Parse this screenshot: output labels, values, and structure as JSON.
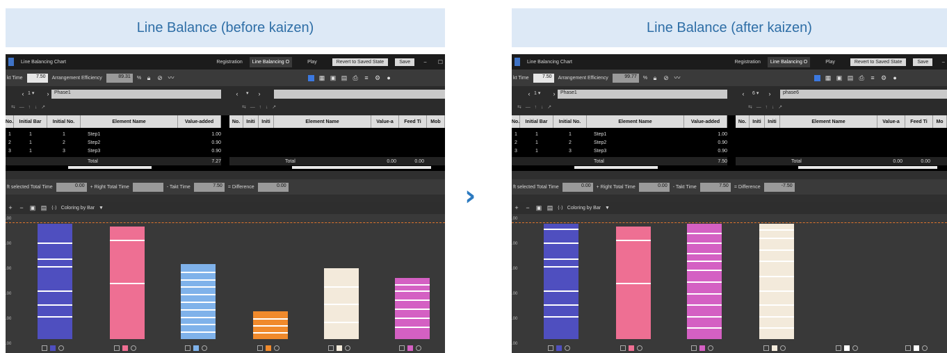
{
  "left": {
    "title": "Line Balance (before kaizen)",
    "app_title": "Line Balancing Chart",
    "tabs": [
      "Registration",
      "Line Balancing O",
      "Play"
    ],
    "revert_label": "Revert to Saved State",
    "save_label": "Save",
    "takt_label": "kt Time",
    "takt_value": "7.50",
    "efficiency_label": "Arrangement Efficiency",
    "efficiency_value": "89.31",
    "percent": "%",
    "phase_left": "Phase1",
    "phase_right": "",
    "left_headers": [
      "No.",
      "Initial Bar",
      "Initial No.",
      "Element Name",
      "Value-added"
    ],
    "right_headers": [
      "No.",
      "Initi",
      "Initi",
      "Element Name",
      "Value-a",
      "Feed Ti",
      "Mob"
    ],
    "rows": [
      {
        "no": "1",
        "bar": "1",
        "ino": "1",
        "name": "Step1",
        "value": "1.00"
      },
      {
        "no": "2",
        "bar": "1",
        "ino": "2",
        "name": "Step2",
        "value": "0.90"
      },
      {
        "no": "3",
        "bar": "1",
        "ino": "3",
        "name": "Step3",
        "value": "0.90"
      }
    ],
    "total_label": "Total",
    "total_value": "7.27",
    "right_total_label": "Total",
    "right_total_values": [
      "0.00",
      "0.00"
    ],
    "sum_left_label": "ft selected Total Time",
    "sum_left_value": "0.00",
    "sum_plus_label": "+ Right Total Time",
    "sum_right_value": "",
    "sum_takt_label": "- Takt Time",
    "sum_takt_value": "7.50",
    "sum_diff_label": "= Difference",
    "sum_diff_value": "0.00",
    "coloring_label": "Coloring by Bar",
    "y_ticks": [
      ".00",
      ".00",
      ".00",
      ".00",
      ".00",
      ".00"
    ]
  },
  "right": {
    "title": "Line Balance (after kaizen)",
    "app_title": "Line Balancing Chart",
    "tabs": [
      "Registration",
      "Line Balancing O",
      "Play"
    ],
    "revert_label": "Revert to Saved State",
    "save_label": "Save",
    "takt_label": "kt Time",
    "takt_value": "7.50",
    "efficiency_label": "Arrangement Efficiency",
    "efficiency_value": "99.77",
    "percent": "%",
    "phase_left": "Phase1",
    "phase_right": "phase6",
    "left_headers": [
      "No.",
      "Initial Bar",
      "Initial No.",
      "Element Name",
      "Value-added"
    ],
    "right_headers": [
      "No.",
      "Initi",
      "Initi",
      "Element Name",
      "Value-a",
      "Feed Ti",
      "Mo"
    ],
    "rows": [
      {
        "no": "1",
        "bar": "1",
        "ino": "1",
        "name": "Step1",
        "value": "1.00"
      },
      {
        "no": "2",
        "bar": "1",
        "ino": "2",
        "name": "Step2",
        "value": "0.90"
      },
      {
        "no": "3",
        "bar": "1",
        "ino": "3",
        "name": "Step3",
        "value": "0.90"
      }
    ],
    "total_label": "Total",
    "total_value": "7.50",
    "right_total_label": "Total",
    "right_total_values": [
      "0.00",
      "0.00"
    ],
    "sum_left_label": "ft selected Total Time",
    "sum_left_value": "0.00",
    "sum_plus_label": "+ Right Total Time",
    "sum_right_value": "0.00",
    "sum_takt_label": "- Takt Time",
    "sum_takt_value": "7.50",
    "sum_diff_label": "= Difference",
    "sum_diff_value": "-7.50",
    "coloring_label": "Coloring by Bar",
    "y_ticks": [
      ".00",
      ".00",
      ".00",
      ".00",
      ".00",
      ".00"
    ]
  },
  "colors": {
    "title_bg": "#dde9f6",
    "title_text": "#2e6ea6",
    "arrow": "#2c7ac0",
    "takt_line": "#e0752c"
  }
}
